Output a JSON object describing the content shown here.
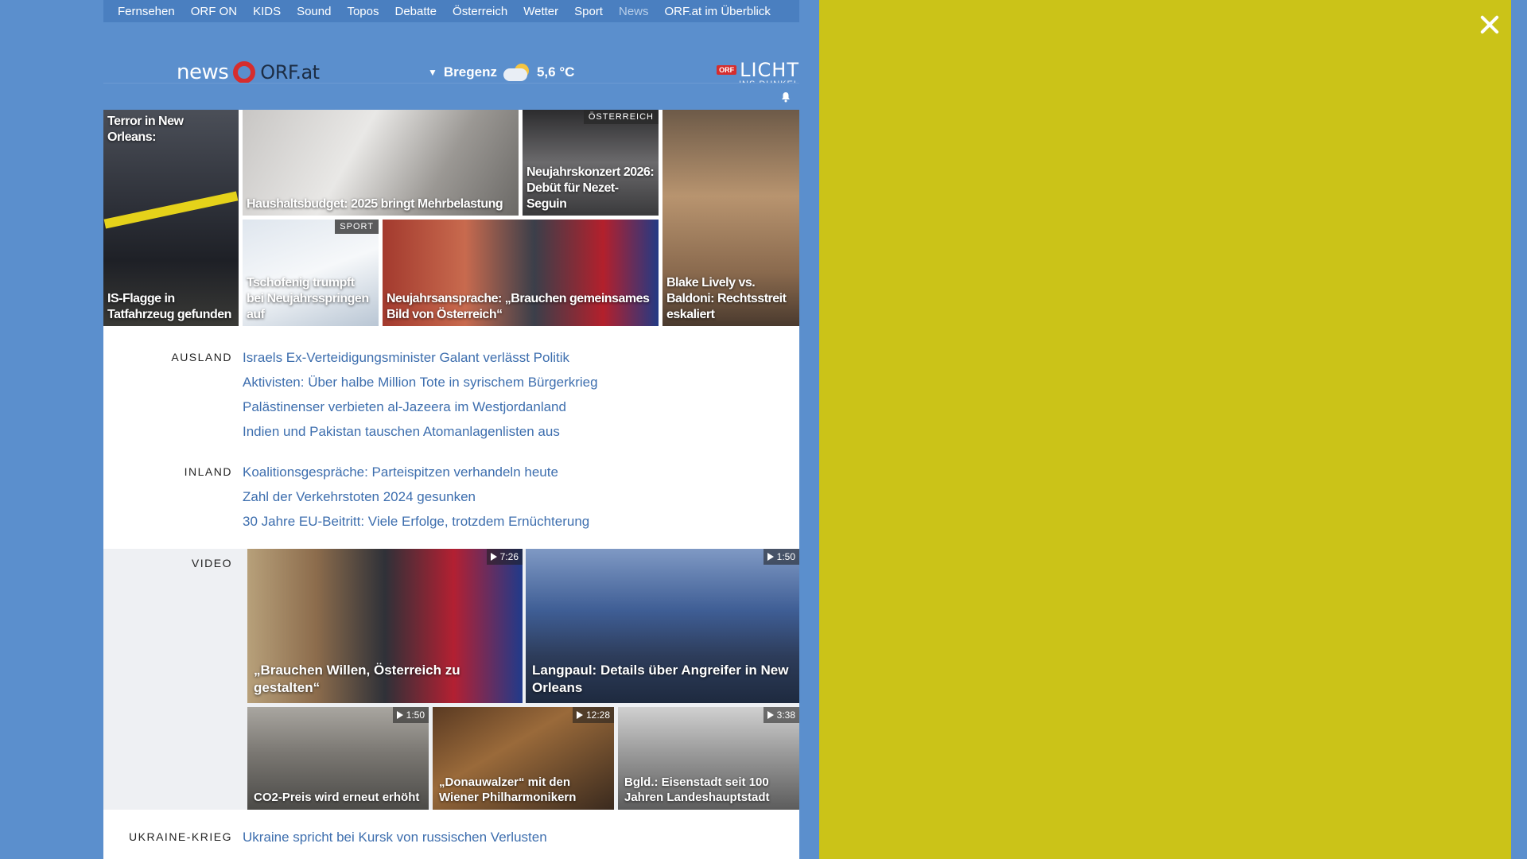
{
  "topnav": {
    "items": [
      "Fernsehen",
      "ORF ON",
      "KIDS",
      "Sound",
      "Topos",
      "Debatte",
      "Österreich",
      "Wetter",
      "Sport",
      "News",
      "ORF.at im Überblick"
    ]
  },
  "header": {
    "logo_news": "news",
    "logo_orf": "ORF.at",
    "weather_location": "Bregenz",
    "weather_temp": "5,6 °C",
    "licht_badge": "ORF",
    "licht_title": "LICHT",
    "licht_sub": "INS DUNKEL"
  },
  "teasers": {
    "t1_top": "Terror in New Orleans:",
    "t1_bottom": "IS-Flagge in Tatfahrzeug gefunden",
    "t2": "Haushaltsbudget: 2025 bringt Mehrbelastung",
    "t3_tag": "ÖSTERREICH",
    "t3": "Neujahrskonzert 2026: Debüt für Nezet-Seguin",
    "t4": "Blake Lively vs. Baldoni: Rechtsstreit eskaliert",
    "t5_tag": "SPORT",
    "t5": "Tschofenig trumpft bei Neujahrsspringen auf",
    "t6": "Neujahrsansprache: „Brauchen gemeinsames Bild von Österreich“"
  },
  "ausland": {
    "label": "AUSLAND",
    "items": [
      "Israels Ex-Verteidigungsminister Galant verlässt Politik",
      "Aktivisten: Über halbe Million Tote in syrischem Bürgerkrieg",
      "Palästinenser verbieten al-Jazeera im Westjordanland",
      "Indien und Pakistan tauschen Atomanlagenlisten aus"
    ]
  },
  "inland": {
    "label": "INLAND",
    "items": [
      "Koalitionsgespräche: Parteispitzen verhandeln heute",
      "Zahl der Verkehrstoten 2024 gesunken",
      "30 Jahre EU-Beitritt: Viele Erfolge, trotzdem Ernüchterung"
    ]
  },
  "video": {
    "label": "VIDEO",
    "tiles": [
      {
        "duration": "7:26",
        "caption": "„Brauchen Willen, Österreich zu gestalten“"
      },
      {
        "duration": "1:50",
        "caption": "Langpaul: Details über Angreifer in New Orleans"
      },
      {
        "duration": "1:50",
        "caption": "CO2-Preis wird erneut erhöht"
      },
      {
        "duration": "12:28",
        "caption": "„Donauwalzer“ mit den Wiener Philharmonikern"
      },
      {
        "duration": "3:38",
        "caption": "Bgld.: Eisenstadt seit 100 Jahren Landeshauptstadt"
      }
    ]
  },
  "ukraine": {
    "label": "UKRAINE-KRIEG",
    "items": [
      "Ukraine spricht bei Kursk von russischen Verlusten"
    ]
  },
  "colors": {
    "site_bg": "#5b8fcd",
    "overlay_bg": "#cbc318",
    "link": "#3d6eae",
    "orf_red": "#d62d2d"
  }
}
